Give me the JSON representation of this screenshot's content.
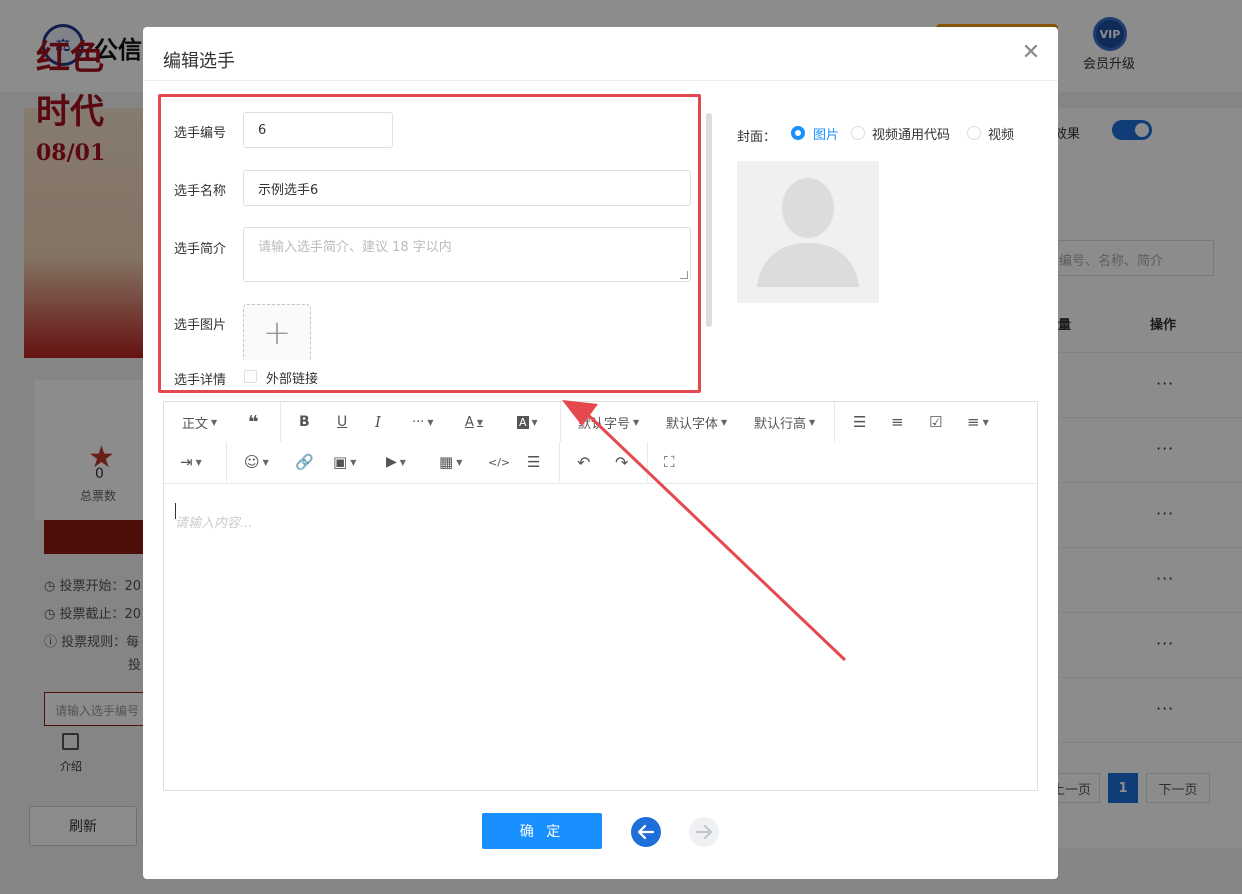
{
  "background": {
    "brand": "公信",
    "vip_badge": "VIP",
    "vip_label": "会员升级",
    "poster_line1": "红色",
    "poster_line2": "时代",
    "poster_date": "08/01",
    "vote_count": "0",
    "vote_label": "总票数",
    "info_start": "投票开始：20",
    "info_end": "投票截止：20",
    "info_rules": "投票规则：每",
    "info_rules_cont": "投",
    "left_search_placeholder": "请输入选手编号",
    "intro_label": "介绍",
    "refresh_label": "刷新",
    "effect_label": "效果",
    "right_search_placeholder": "编号、名称、简介",
    "col_count": "量",
    "col_action": "操作",
    "row_more": "···",
    "prev_label": "上一页",
    "page_current": "1",
    "next_label": "下一页"
  },
  "modal": {
    "title": "编辑选手",
    "close_icon": "close-icon"
  },
  "form": {
    "number_label": "选手编号",
    "number_value": "6",
    "name_label": "选手名称",
    "name_value": "示例选手6",
    "intro_label": "选手简介",
    "intro_placeholder": "请输入选手简介、建议 18 字以内",
    "image_label": "选手图片",
    "upload_icon": "+",
    "detail_label": "选手详情",
    "external_link_label": "外部链接"
  },
  "cover": {
    "label": "封面：",
    "options": [
      "图片",
      "视频通用代码",
      "视频"
    ],
    "selected": "图片"
  },
  "editor": {
    "paragraph": "正文",
    "font_size": "默认字号",
    "font_family": "默认字体",
    "line_height": "默认行高",
    "placeholder": "请输入内容..."
  },
  "actions": {
    "confirm_label": "确 定"
  },
  "colors": {
    "primary": "#1890ff",
    "highlight": "#e5484d",
    "nav_back": "#1e6fd9"
  }
}
